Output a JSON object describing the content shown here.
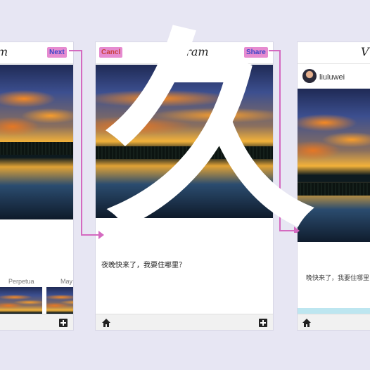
{
  "screens": {
    "left": {
      "logo_partial": "m",
      "next_button": "Next",
      "filters": [
        "Perpetua",
        "May"
      ]
    },
    "middle": {
      "logo_partial": "gram",
      "cancel_button": "Cancl",
      "share_button": "Share",
      "caption": "夜晚快来了，我要住哪里？"
    },
    "right": {
      "logo_partial": "V",
      "username": "liuluwei",
      "caption_partial": "晚快来了，我要住哪里"
    }
  },
  "overlay": {
    "glyph": "久"
  },
  "colors": {
    "background": "#e7e6f3",
    "tag_pink": "#e68bd0",
    "arrow_pink": "#d46ac0"
  }
}
